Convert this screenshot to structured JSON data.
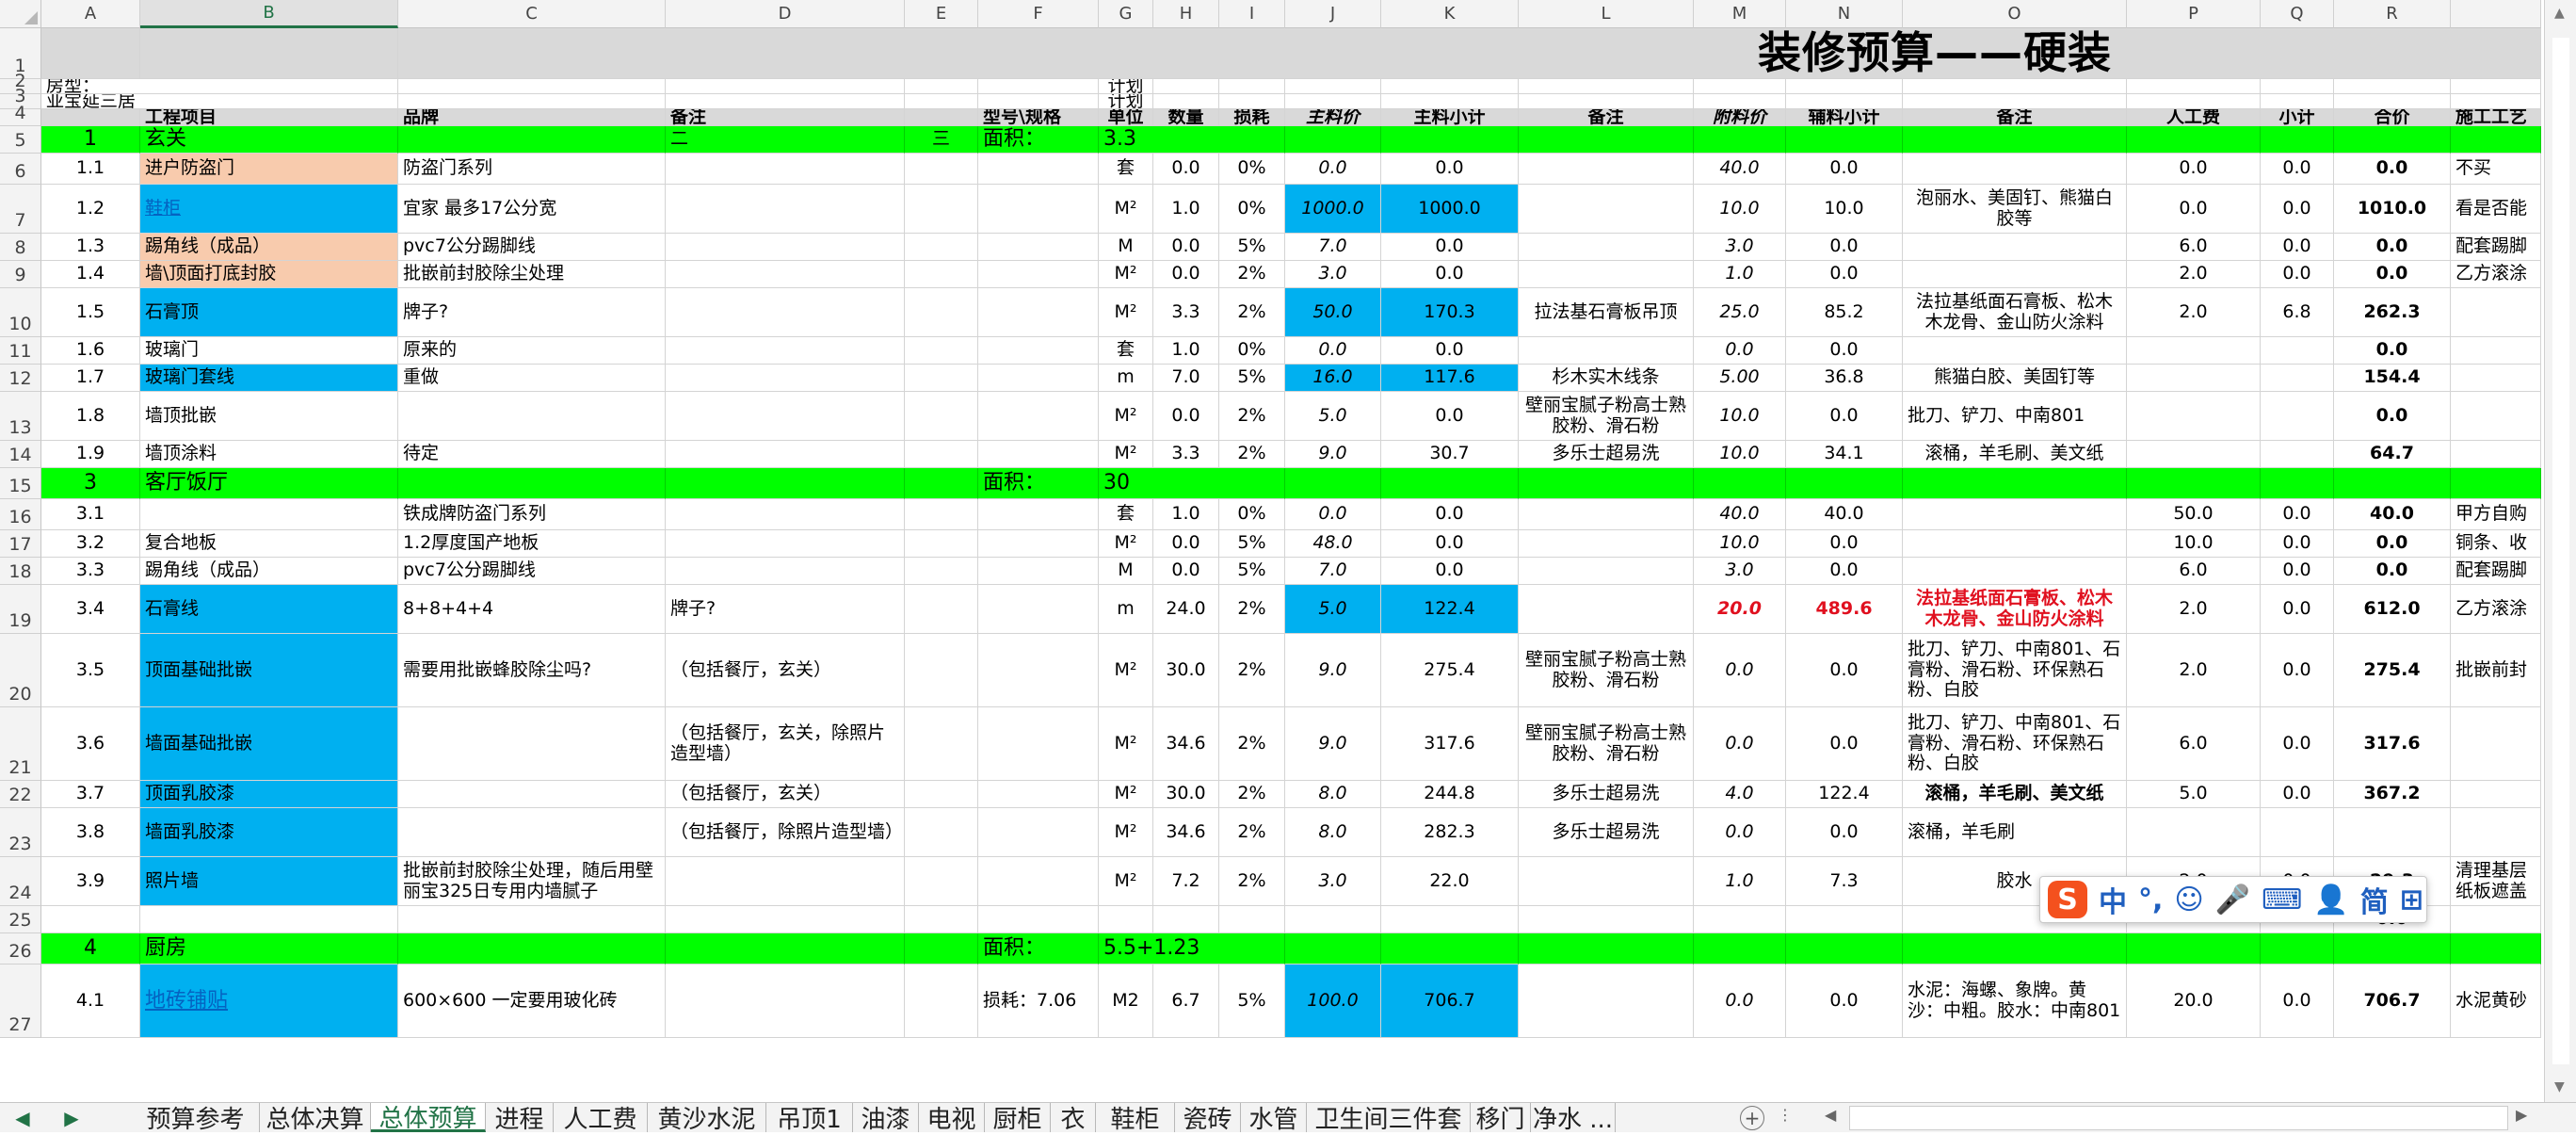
{
  "app": {
    "title": "装修预算——硬装",
    "accent": "#217346"
  },
  "colors": {
    "section": "#00ff00",
    "blue": "#00b0f0",
    "orange": "#f8cbad",
    "header_gray": "#d9d9d9"
  },
  "columns": [
    "A",
    "B",
    "C",
    "D",
    "E",
    "F",
    "G",
    "H",
    "I",
    "J",
    "K",
    "L",
    "M",
    "N",
    "O",
    "P",
    "Q",
    "R",
    ""
  ],
  "selected_column": "B",
  "rows": [
    {
      "n": "1",
      "h": 54,
      "hb": "gray",
      "cells": {
        "A": "",
        "B": "",
        "C": {
          "t": "装修预算——硬装",
          "span": 18,
          "title": true
        }
      }
    },
    {
      "n": "2",
      "h": 16,
      "hb": "white",
      "cells": {
        "A": {
          "t": "房型：",
          "span": 2,
          "cls": "l"
        },
        "G": "计划"
      }
    },
    {
      "n": "3",
      "h": 16,
      "hb": "white",
      "cells": {
        "A": {
          "t": "亚宝延三居",
          "span": 2,
          "cls": "l"
        },
        "G": "计划"
      }
    },
    {
      "n": "4",
      "h": 18,
      "hb": "gray",
      "cells": {
        "A": "",
        "B": {
          "t": "工程项目",
          "cls": "l b"
        },
        "C": {
          "t": "品牌",
          "cls": "l b"
        },
        "D": {
          "t": "备注",
          "cls": "l b"
        },
        "E": "",
        "F": {
          "t": "型号\\规格",
          "cls": "l b"
        },
        "G": {
          "t": "单位",
          "cls": "b"
        },
        "H": {
          "t": "数量",
          "cls": "b"
        },
        "I": {
          "t": "损耗",
          "cls": "b"
        },
        "J": {
          "t": "主料价",
          "cls": "b i"
        },
        "K": {
          "t": "主料小计",
          "cls": "b"
        },
        "L": {
          "t": "备注",
          "cls": "b"
        },
        "M": {
          "t": "附料价",
          "cls": "b i"
        },
        "N": {
          "t": "辅料小计",
          "cls": "b"
        },
        "O": {
          "t": "备注",
          "cls": "b"
        },
        "P": {
          "t": "人工费",
          "cls": "b"
        },
        "Q": {
          "t": "小计",
          "cls": "b"
        },
        "R": {
          "t": "合价",
          "cls": "b"
        },
        "S": {
          "t": "施工工艺",
          "cls": "l b"
        }
      }
    },
    {
      "n": "5",
      "h": 29,
      "hb": "green",
      "cells": {
        "A": {
          "t": "1",
          "cls": "big"
        },
        "B": {
          "t": "玄关",
          "cls": "l big"
        },
        "D": {
          "t": "二",
          "cls": "l"
        },
        "E": "三",
        "F": {
          "t": "面积：",
          "cls": "l big"
        },
        "G": {
          "t": "3.3",
          "span": 3,
          "cls": "l big"
        }
      }
    },
    {
      "n": "6",
      "h": 33,
      "cells": {
        "A": "1.1",
        "B": {
          "t": "进户防盗门",
          "cls": "l",
          "bg": "orange"
        },
        "C": {
          "t": "防盗门系列",
          "cls": "l"
        },
        "G": "套",
        "H": "0.0",
        "I": "0%",
        "J": {
          "t": "0.0",
          "cls": "i"
        },
        "K": "0.0",
        "M": {
          "t": "40.0",
          "cls": "i"
        },
        "N": "0.0",
        "P": "0.0",
        "Q": "0.0",
        "R": {
          "t": "0.0",
          "cls": "b"
        },
        "S": {
          "t": "不买",
          "cls": "l"
        }
      }
    },
    {
      "n": "7",
      "h": 52,
      "cells": {
        "A": "1.2",
        "B": {
          "t": "鞋柜",
          "cls": "l link",
          "bg": "blue"
        },
        "C": {
          "t": "宜家 最多17公分宽",
          "cls": "l"
        },
        "G": "M²",
        "H": "1.0",
        "I": "0%",
        "J": {
          "t": "1000.0",
          "cls": "i",
          "bg": "blue"
        },
        "K": {
          "t": "1000.0",
          "bg": "blue"
        },
        "M": {
          "t": "10.0",
          "cls": "i"
        },
        "N": "10.0",
        "O": "泡丽水、美固钉、熊猫白胶等",
        "P": "0.0",
        "Q": "0.0",
        "R": {
          "t": "1010.0",
          "cls": "b"
        },
        "S": {
          "t": "看是否能",
          "cls": "l"
        }
      }
    },
    {
      "n": "8",
      "h": 29,
      "cells": {
        "A": "1.3",
        "B": {
          "t": "踢角线（成品）",
          "cls": "l",
          "bg": "orange"
        },
        "C": {
          "t": "pvc7公分踢脚线",
          "cls": "l"
        },
        "G": "M",
        "H": "0.0",
        "I": "5%",
        "J": {
          "t": "7.0",
          "cls": "i"
        },
        "K": "0.0",
        "M": {
          "t": "3.0",
          "cls": "i"
        },
        "N": "0.0",
        "P": "6.0",
        "Q": "0.0",
        "R": {
          "t": "0.0",
          "cls": "b"
        },
        "S": {
          "t": "配套踢脚",
          "cls": "l"
        }
      }
    },
    {
      "n": "9",
      "h": 29,
      "cells": {
        "A": "1.4",
        "B": {
          "t": "墙\\顶面打底封胶",
          "cls": "l",
          "bg": "orange"
        },
        "C": {
          "t": "批嵌前封胶除尘处理",
          "cls": "l"
        },
        "G": "M²",
        "H": "0.0",
        "I": "2%",
        "J": {
          "t": "3.0",
          "cls": "i"
        },
        "K": "0.0",
        "M": {
          "t": "1.0",
          "cls": "i"
        },
        "N": "0.0",
        "P": "2.0",
        "Q": "0.0",
        "R": {
          "t": "0.0",
          "cls": "b"
        },
        "S": {
          "t": "乙方滚涂",
          "cls": "l"
        }
      }
    },
    {
      "n": "10",
      "h": 52,
      "cells": {
        "A": "1.5",
        "B": {
          "t": "石膏顶",
          "cls": "l",
          "bg": "blue"
        },
        "C": {
          "t": "牌子?",
          "cls": "l"
        },
        "G": "M²",
        "H": "3.3",
        "I": "2%",
        "J": {
          "t": "50.0",
          "cls": "i",
          "bg": "blue"
        },
        "K": {
          "t": "170.3",
          "bg": "blue"
        },
        "L": "拉法基石膏板吊顶",
        "M": {
          "t": "25.0",
          "cls": "i"
        },
        "N": "85.2",
        "O": "法拉基纸面石膏板、松木木龙骨、金山防火涂料",
        "P": "2.0",
        "Q": "6.8",
        "R": {
          "t": "262.3",
          "cls": "b"
        }
      }
    },
    {
      "n": "11",
      "h": 29,
      "cells": {
        "A": "1.6",
        "B": {
          "t": "玻璃门",
          "cls": "l"
        },
        "C": {
          "t": "原来的",
          "cls": "l"
        },
        "G": "套",
        "H": "1.0",
        "I": "0%",
        "J": {
          "t": "0.0",
          "cls": "i"
        },
        "K": "0.0",
        "M": {
          "t": "0.0",
          "cls": "i"
        },
        "N": "0.0",
        "R": {
          "t": "0.0",
          "cls": "b"
        }
      }
    },
    {
      "n": "12",
      "h": 29,
      "cells": {
        "A": "1.7",
        "B": {
          "t": "玻璃门套线",
          "cls": "l",
          "bg": "blue"
        },
        "C": {
          "t": "重做",
          "cls": "l"
        },
        "G": "m",
        "H": "7.0",
        "I": "5%",
        "J": {
          "t": "16.0",
          "cls": "i",
          "bg": "blue"
        },
        "K": {
          "t": "117.6",
          "bg": "blue"
        },
        "L": "杉木实木线条",
        "M": {
          "t": "5.00",
          "cls": "i"
        },
        "N": "36.8",
        "O": "熊猫白胶、美固钉等",
        "R": {
          "t": "154.4",
          "cls": "b"
        }
      }
    },
    {
      "n": "13",
      "h": 52,
      "cells": {
        "A": "1.8",
        "B": {
          "t": "墙顶批嵌",
          "cls": "l"
        },
        "G": "M²",
        "H": "0.0",
        "I": "2%",
        "J": {
          "t": "5.0",
          "cls": "i"
        },
        "K": "0.0",
        "L": "壁丽宝腻子粉高士熟胶粉、滑石粉",
        "M": {
          "t": "10.0",
          "cls": "i"
        },
        "N": "0.0",
        "O": {
          "t": "批刀、铲刀、中南801",
          "cls": "l"
        },
        "R": {
          "t": "0.0",
          "cls": "b"
        }
      }
    },
    {
      "n": "14",
      "h": 29,
      "cells": {
        "A": "1.9",
        "B": {
          "t": "墙顶涂料",
          "cls": "l"
        },
        "C": {
          "t": "待定",
          "cls": "l"
        },
        "G": "M²",
        "H": "3.3",
        "I": "2%",
        "J": {
          "t": "9.0",
          "cls": "i"
        },
        "K": "30.7",
        "L": "多乐士超易洗",
        "M": {
          "t": "10.0",
          "cls": "i"
        },
        "N": "34.1",
        "O": "滚桶，羊毛刷、美文纸",
        "R": {
          "t": "64.7",
          "cls": "b"
        }
      }
    },
    {
      "n": "15",
      "h": 33,
      "hb": "green",
      "cells": {
        "A": {
          "t": "3",
          "cls": "big"
        },
        "B": {
          "t": "客厅饭厅",
          "cls": "l big"
        },
        "F": {
          "t": "面积：",
          "cls": "l big"
        },
        "G": {
          "t": "30",
          "span": 3,
          "cls": "l big"
        }
      }
    },
    {
      "n": "16",
      "h": 33,
      "cells": {
        "A": "3.1",
        "C": {
          "t": "铁成牌防盗门系列",
          "cls": "l"
        },
        "G": "套",
        "H": "1.0",
        "I": "0%",
        "J": {
          "t": "0.0",
          "cls": "i"
        },
        "K": "0.0",
        "M": {
          "t": "40.0",
          "cls": "i"
        },
        "N": "40.0",
        "P": "50.0",
        "Q": "0.0",
        "R": {
          "t": "40.0",
          "cls": "b"
        },
        "S": {
          "t": "甲方自购",
          "cls": "l"
        }
      }
    },
    {
      "n": "17",
      "h": 29,
      "cells": {
        "A": "3.2",
        "B": {
          "t": "复合地板",
          "cls": "l"
        },
        "C": {
          "t": "1.2厚度国产地板",
          "cls": "l"
        },
        "G": "M²",
        "H": "0.0",
        "I": "5%",
        "J": {
          "t": "48.0",
          "cls": "i"
        },
        "K": "0.0",
        "M": {
          "t": "10.0",
          "cls": "i"
        },
        "N": "0.0",
        "P": "10.0",
        "Q": "0.0",
        "R": {
          "t": "0.0",
          "cls": "b"
        },
        "S": {
          "t": "铜条、收",
          "cls": "l"
        }
      }
    },
    {
      "n": "18",
      "h": 29,
      "cells": {
        "A": "3.3",
        "B": {
          "t": "踢角线（成品）",
          "cls": "l"
        },
        "C": {
          "t": "pvc7公分踢脚线",
          "cls": "l"
        },
        "G": "M",
        "H": "0.0",
        "I": "5%",
        "J": {
          "t": "7.0",
          "cls": "i"
        },
        "K": "0.0",
        "M": {
          "t": "3.0",
          "cls": "i"
        },
        "N": "0.0",
        "P": "6.0",
        "Q": "0.0",
        "R": {
          "t": "0.0",
          "cls": "b"
        },
        "S": {
          "t": "配套踢脚",
          "cls": "l"
        }
      }
    },
    {
      "n": "19",
      "h": 52,
      "cells": {
        "A": "3.4",
        "B": {
          "t": "石膏线",
          "cls": "l",
          "bg": "blue"
        },
        "C": {
          "t": "8+8+4+4",
          "cls": "l"
        },
        "D": {
          "t": "牌子?",
          "cls": "l"
        },
        "G": "m",
        "H": "24.0",
        "I": "2%",
        "J": {
          "t": "5.0",
          "cls": "i",
          "bg": "blue"
        },
        "K": {
          "t": "122.4",
          "bg": "blue"
        },
        "M": {
          "t": "20.0",
          "cls": "i red"
        },
        "N": {
          "t": "489.6",
          "cls": "red"
        },
        "O": {
          "t": "法拉基纸面石膏板、松木木龙骨、金山防火涂料",
          "cls": "red"
        },
        "P": "2.0",
        "Q": "0.0",
        "R": {
          "t": "612.0",
          "cls": "b"
        },
        "S": {
          "t": "乙方滚涂",
          "cls": "l"
        }
      }
    },
    {
      "n": "20",
      "h": 78,
      "cells": {
        "A": "3.5",
        "B": {
          "t": "顶面基础批嵌",
          "cls": "l",
          "bg": "blue"
        },
        "C": {
          "t": "需要用批嵌蜂胶除尘吗?",
          "cls": "l"
        },
        "D": {
          "t": "（包括餐厅，玄关）",
          "cls": "l"
        },
        "G": "M²",
        "H": "30.0",
        "I": "2%",
        "J": {
          "t": "9.0",
          "cls": "i"
        },
        "K": "275.4",
        "L": "壁丽宝腻子粉高士熟胶粉、滑石粉",
        "M": {
          "t": "0.0",
          "cls": "i"
        },
        "N": "0.0",
        "O": {
          "t": "批刀、铲刀、中南801、石膏粉、滑石粉、环保熟石粉、白胶",
          "cls": "l"
        },
        "P": "2.0",
        "Q": "0.0",
        "R": {
          "t": "275.4",
          "cls": "b"
        },
        "S": {
          "t": "批嵌前封",
          "cls": "l"
        }
      }
    },
    {
      "n": "21",
      "h": 78,
      "cells": {
        "A": "3.6",
        "B": {
          "t": "墙面基础批嵌",
          "cls": "l",
          "bg": "blue"
        },
        "D": {
          "t": "（包括餐厅，玄关，除照片造型墙）",
          "cls": "l"
        },
        "G": "M²",
        "H": "34.6",
        "I": "2%",
        "J": {
          "t": "9.0",
          "cls": "i"
        },
        "K": "317.6",
        "L": "壁丽宝腻子粉高士熟胶粉、滑石粉",
        "M": {
          "t": "0.0",
          "cls": "i"
        },
        "N": "0.0",
        "O": {
          "t": "批刀、铲刀、中南801、石膏粉、滑石粉、环保熟石粉、白胶",
          "cls": "l"
        },
        "P": "6.0",
        "Q": "0.0",
        "R": {
          "t": "317.6",
          "cls": "b"
        }
      }
    },
    {
      "n": "22",
      "h": 29,
      "cells": {
        "A": "3.7",
        "B": {
          "t": "顶面乳胶漆",
          "cls": "l",
          "bg": "blue"
        },
        "D": {
          "t": "（包括餐厅，玄关）",
          "cls": "l"
        },
        "G": "M²",
        "H": "30.0",
        "I": "2%",
        "J": {
          "t": "8.0",
          "cls": "i"
        },
        "K": "244.8",
        "L": "多乐士超易洗",
        "M": {
          "t": "4.0",
          "cls": "i"
        },
        "N": "122.4",
        "O": {
          "t": "滚桶，羊毛刷、美文纸",
          "cls": "b"
        },
        "P": "5.0",
        "Q": "0.0",
        "R": {
          "t": "367.2",
          "cls": "b"
        }
      }
    },
    {
      "n": "23",
      "h": 52,
      "cells": {
        "A": "3.8",
        "B": {
          "t": "墙面乳胶漆",
          "cls": "l",
          "bg": "blue"
        },
        "D": {
          "t": "（包括餐厅，除照片造型墙）",
          "cls": "l"
        },
        "G": "M²",
        "H": "34.6",
        "I": "2%",
        "J": {
          "t": "8.0",
          "cls": "i"
        },
        "K": "282.3",
        "L": "多乐士超易洗",
        "M": {
          "t": "0.0",
          "cls": "i"
        },
        "N": "0.0",
        "O": {
          "t": "滚桶，羊毛刷",
          "cls": "l"
        }
      }
    },
    {
      "n": "24",
      "h": 52,
      "cells": {
        "A": "3.9",
        "B": {
          "t": "照片墙",
          "cls": "l",
          "bg": "blue"
        },
        "C": {
          "t": "批嵌前封胶除尘处理，随后用壁丽宝325日专用内墙腻子",
          "cls": "l"
        },
        "G": "M²",
        "H": "7.2",
        "I": "2%",
        "J": {
          "t": "3.0",
          "cls": "i"
        },
        "K": "22.0",
        "M": {
          "t": "1.0",
          "cls": "i"
        },
        "N": "7.3",
        "O": "胶水",
        "P": "2.0",
        "Q": "0.0",
        "R": {
          "t": "29.3",
          "cls": "b"
        },
        "S": {
          "t": "清理基层纸板遮盖",
          "cls": "l"
        }
      }
    },
    {
      "n": "25",
      "h": 29,
      "cells": {
        "R": {
          "t": "0.0",
          "cls": "b"
        }
      }
    },
    {
      "n": "26",
      "h": 33,
      "hb": "green",
      "cells": {
        "A": {
          "t": "4",
          "cls": "big"
        },
        "B": {
          "t": "厨房",
          "cls": "l big"
        },
        "F": {
          "t": "面积：",
          "cls": "l big"
        },
        "G": {
          "t": "5.5+1.23",
          "span": 3,
          "cls": "l big"
        }
      }
    },
    {
      "n": "27",
      "h": 78,
      "cells": {
        "A": "4.1",
        "B": {
          "t": "地砖铺贴",
          "cls": "l link big",
          "bg": "blue"
        },
        "C": {
          "t": "600×600 一定要用玻化砖",
          "cls": "l"
        },
        "F": {
          "t": "损耗：7.06",
          "cls": "l"
        },
        "G": "M2",
        "H": "6.7",
        "I": "5%",
        "J": {
          "t": "100.0",
          "cls": "i",
          "bg": "blue"
        },
        "K": {
          "t": "706.7",
          "bg": "blue"
        },
        "M": {
          "t": "0.0",
          "cls": "i"
        },
        "N": "0.0",
        "O": {
          "t": "水泥：海螺、象牌。黄沙：中粗。胶水：中南801",
          "cls": "l"
        },
        "P": "20.0",
        "Q": "0.0",
        "R": {
          "t": "706.7",
          "cls": "b"
        },
        "S": {
          "t": "水泥黄砂",
          "cls": "l"
        }
      }
    }
  ],
  "sheet_tabs": [
    "预算参考",
    "总体决算",
    "总体预算",
    "进程",
    "人工费",
    "黄沙水泥",
    "吊顶1",
    "油漆",
    "电视",
    "厨柜",
    "衣",
    "鞋柜",
    "瓷砖",
    "水管",
    "卫生间三件套",
    "移门",
    "净水 ..."
  ],
  "active_tab": "总体预算",
  "ime": {
    "logo": "S",
    "items": [
      "中",
      "°,",
      "☺",
      "🎤",
      "⌨",
      "👤",
      "简",
      "⊞"
    ]
  }
}
